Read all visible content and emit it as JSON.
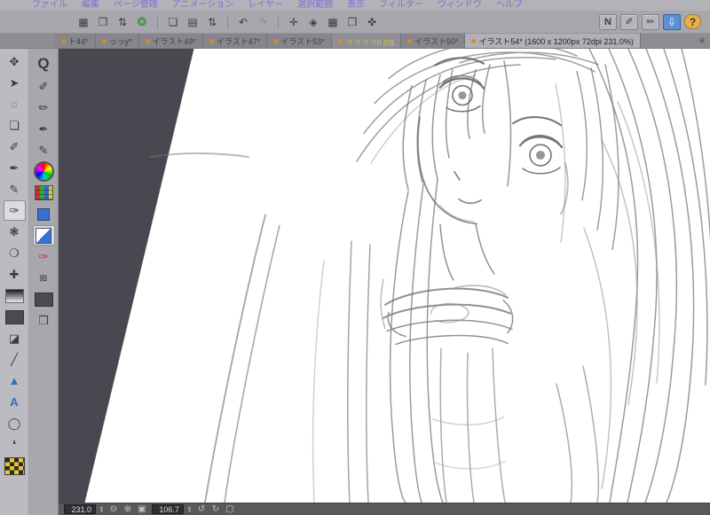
{
  "colors": {
    "accent_blue": "#5b8fd6",
    "tab_dot_orange": "#d98a2b",
    "help_orange": "#e8b14e",
    "canvas_workspace_gray": "#49484d",
    "sketch_stroke_gray": "#75757c"
  },
  "menubar": {
    "items": [
      {
        "label": "ファイル"
      },
      {
        "label": "編集"
      },
      {
        "label": "ページ管理"
      },
      {
        "label": "アニメーション"
      },
      {
        "label": "レイヤー"
      },
      {
        "label": "選択範囲"
      },
      {
        "label": "表示"
      },
      {
        "label": "フィルター"
      },
      {
        "label": "ウィンドウ"
      },
      {
        "label": "ヘルプ"
      }
    ]
  },
  "toolbar": {
    "left_icons": [
      {
        "name": "workspace-grid-icon",
        "glyph": "▦"
      },
      {
        "name": "page-manager-icon",
        "glyph": "❐"
      },
      {
        "name": "page-stepper-icon",
        "glyph": "⇅"
      },
      {
        "name": "animation-swirl-icon",
        "glyph": "❂",
        "cls": "green"
      },
      {
        "sep": true
      },
      {
        "name": "new-page-icon",
        "glyph": "❏"
      },
      {
        "name": "open-folder-icon",
        "glyph": "▤"
      },
      {
        "name": "page-nav-stepper-icon",
        "glyph": "⇅"
      },
      {
        "sep": true
      },
      {
        "name": "undo-icon",
        "glyph": "↶"
      },
      {
        "name": "redo-icon",
        "glyph": "↷",
        "cls": "disabled"
      },
      {
        "sep": true
      },
      {
        "name": "snap-crosshair-icon",
        "glyph": "✛"
      },
      {
        "name": "snap-ruler-icon",
        "glyph": "◈"
      },
      {
        "name": "snap-grid-icon",
        "glyph": "▦"
      },
      {
        "name": "material-icon",
        "glyph": "❒"
      },
      {
        "name": "transform-icon",
        "glyph": "✜"
      }
    ],
    "right_icons": [
      {
        "name": "pen-pressure-icon",
        "glyph": "N",
        "cls": "boxed"
      },
      {
        "name": "stroke-correction-icon",
        "glyph": "✐",
        "cls": "boxed"
      },
      {
        "name": "stroke-correction2-icon",
        "glyph": "✏",
        "cls": "boxed"
      },
      {
        "name": "down-arrow-button",
        "glyph": "⇩",
        "cls": "active-blue"
      },
      {
        "name": "help-button",
        "glyph": "?",
        "cls": "help"
      }
    ]
  },
  "tabbar": {
    "tabs": [
      {
        "label": "ト44*"
      },
      {
        "label": "っっy*"
      },
      {
        "label": "イラスト49*"
      },
      {
        "label": "イラスト47*"
      },
      {
        "label": "イラスト53*"
      },
      {
        "label": "っっっっp.jpg",
        "highlight": true
      },
      {
        "label": "イラスト50*"
      },
      {
        "label": "イラスト54* (1600 x 1200px 72dpi 231.0%)",
        "active": true
      }
    ],
    "end_glyph": "≡"
  },
  "tools": {
    "column1": [
      {
        "name": "hand-tool",
        "glyph": "✥"
      },
      {
        "name": "move-tool",
        "glyph": "➤"
      },
      {
        "name": "lasso-tool",
        "glyph": "◌"
      },
      {
        "name": "frame-tool",
        "glyph": "❏"
      },
      {
        "name": "eyedropper-tool",
        "glyph": "✐"
      },
      {
        "name": "pen-tool",
        "glyph": "✒"
      },
      {
        "name": "pencil-tool",
        "glyph": "✎"
      },
      {
        "name": "brush-tool",
        "glyph": "✑",
        "selected": true
      },
      {
        "name": "watercolor-tool",
        "glyph": "❃"
      },
      {
        "name": "blend-tool",
        "glyph": "❍"
      },
      {
        "name": "decoration-tool",
        "glyph": "✚"
      },
      {
        "name": "gradient-tool",
        "kind": "gradbox"
      },
      {
        "name": "dark-brush-tool",
        "kind": "dark"
      },
      {
        "name": "eraser-tool",
        "glyph": "◪"
      },
      {
        "name": "line-tool",
        "glyph": "╱"
      },
      {
        "name": "cursor-tool",
        "glyph": "▲",
        "cls": "blue"
      },
      {
        "name": "text-tool",
        "glyph": "A",
        "cls": "blue"
      },
      {
        "name": "figure-tool",
        "glyph": "◯"
      },
      {
        "name": "balloon-tool",
        "glyph": "❛"
      },
      {
        "name": "transparent-color-swatch",
        "kind": "checker"
      }
    ],
    "column2": [
      {
        "name": "zoom-tool",
        "glyph": "Q",
        "cls": "big"
      },
      {
        "name": "subtool-draw-icon",
        "glyph": "✐"
      },
      {
        "name": "subtool-pencil-icon",
        "glyph": "✏"
      },
      {
        "name": "subtool-pen-icon",
        "glyph": "✒"
      },
      {
        "name": "subtool-marker-icon",
        "glyph": "✎"
      },
      {
        "name": "color-wheel",
        "kind": "wheel"
      },
      {
        "name": "color-set",
        "kind": "palette"
      },
      {
        "name": "color-history",
        "kind": "bluesq"
      },
      {
        "name": "drawing-color-swatch",
        "kind": "pair",
        "selected": true
      },
      {
        "name": "red-brush-tool",
        "glyph": "✑",
        "cls": "red"
      },
      {
        "name": "tone-tool",
        "glyph": "≋"
      },
      {
        "name": "gray-panel",
        "kind": "dark"
      },
      {
        "name": "material-panel-icon",
        "glyph": "❒"
      }
    ]
  },
  "statusbar": {
    "zoom_value": "231.0",
    "rotation_value": "106.7",
    "zoom_icons": [
      {
        "name": "zoom-out-icon",
        "glyph": "⊖"
      },
      {
        "name": "zoom-in-icon",
        "glyph": "⊕"
      },
      {
        "name": "fit-screen-icon",
        "glyph": "▣"
      }
    ],
    "rotate_icons": [
      {
        "name": "rotate-ccw-icon",
        "glyph": "↺"
      },
      {
        "name": "rotate-cw-icon",
        "glyph": "↻"
      },
      {
        "name": "reset-view-icon",
        "glyph": "▢"
      }
    ]
  }
}
